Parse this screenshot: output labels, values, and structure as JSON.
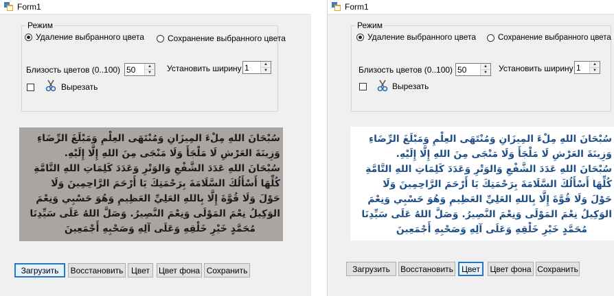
{
  "window": {
    "title": "Form1"
  },
  "mode_group": {
    "legend": "Режим",
    "remove_label": "Удаление выбранного цвета",
    "keep_label": "Сохранение выбранного цвета",
    "selected": "remove"
  },
  "proximity": {
    "label": "Близость цветов (0..100)",
    "value": "50"
  },
  "width": {
    "label": "Установить ширину",
    "value": "1"
  },
  "cut": {
    "label": "Вырезать",
    "checked": false
  },
  "image_text": {
    "lines": [
      "سُبْحَانَ اللهِ مِلْءَ المِيزَانِ وَمُنْتَهَى العِلْمِ وَمَبْلَغَ الرِّضَاءِ",
      "وَزِينَةَ العَرْشِ لَا مَلْجَأَ وَلَا مَنْجَى مِنَ اللهِ إِلَّا إِلَيْهِ.",
      "سُبْحَانَ اللهِ عَدَدَ الشَّفْعِ وَالوَتْرِ وَعَدَدَ كَلِمَاتِ اللهِ التَّامَّةِ",
      "كُلِّهَا أَسْأَلُكَ السَّلَامَةَ بِرَحْمَتِكَ يَا أَرْحَمَ الرَّاحِمِينَ وَلَا",
      "حَوْلَ وَلَا قُوَّةَ إِلَّا بِاللهِ العَلِيِّ العَظِيمِ وَهُوَ حَسْبِي وَنِعْمَ",
      "الوَكِيلُ نِعْمَ المَوْلَى وَنِعْمَ النَّصِيرُ. وَصَلَّ اللهُ عَلَى سَيِّدِنَا",
      "مُحَمَّدٍ خَيْرِ خَلْقِهِ وَعَلَى آلِهِ وَصَحْبِهِ أَجْمَعِينَ"
    ]
  },
  "buttons": {
    "load": "Загрузить",
    "restore": "Восстановить",
    "color": "Цвет",
    "bg_color": "Цвет фона",
    "save": "Сохранить"
  },
  "colors": {
    "window_bg": "#f0f0f0",
    "photo_bg": "#a9a5a3",
    "photo_text": "#1d1b1a",
    "processed_text": "#1f4f86",
    "focus_border": "#2a74c7"
  },
  "icons": {
    "app": "form-icon",
    "cut": "scissors-icon"
  }
}
